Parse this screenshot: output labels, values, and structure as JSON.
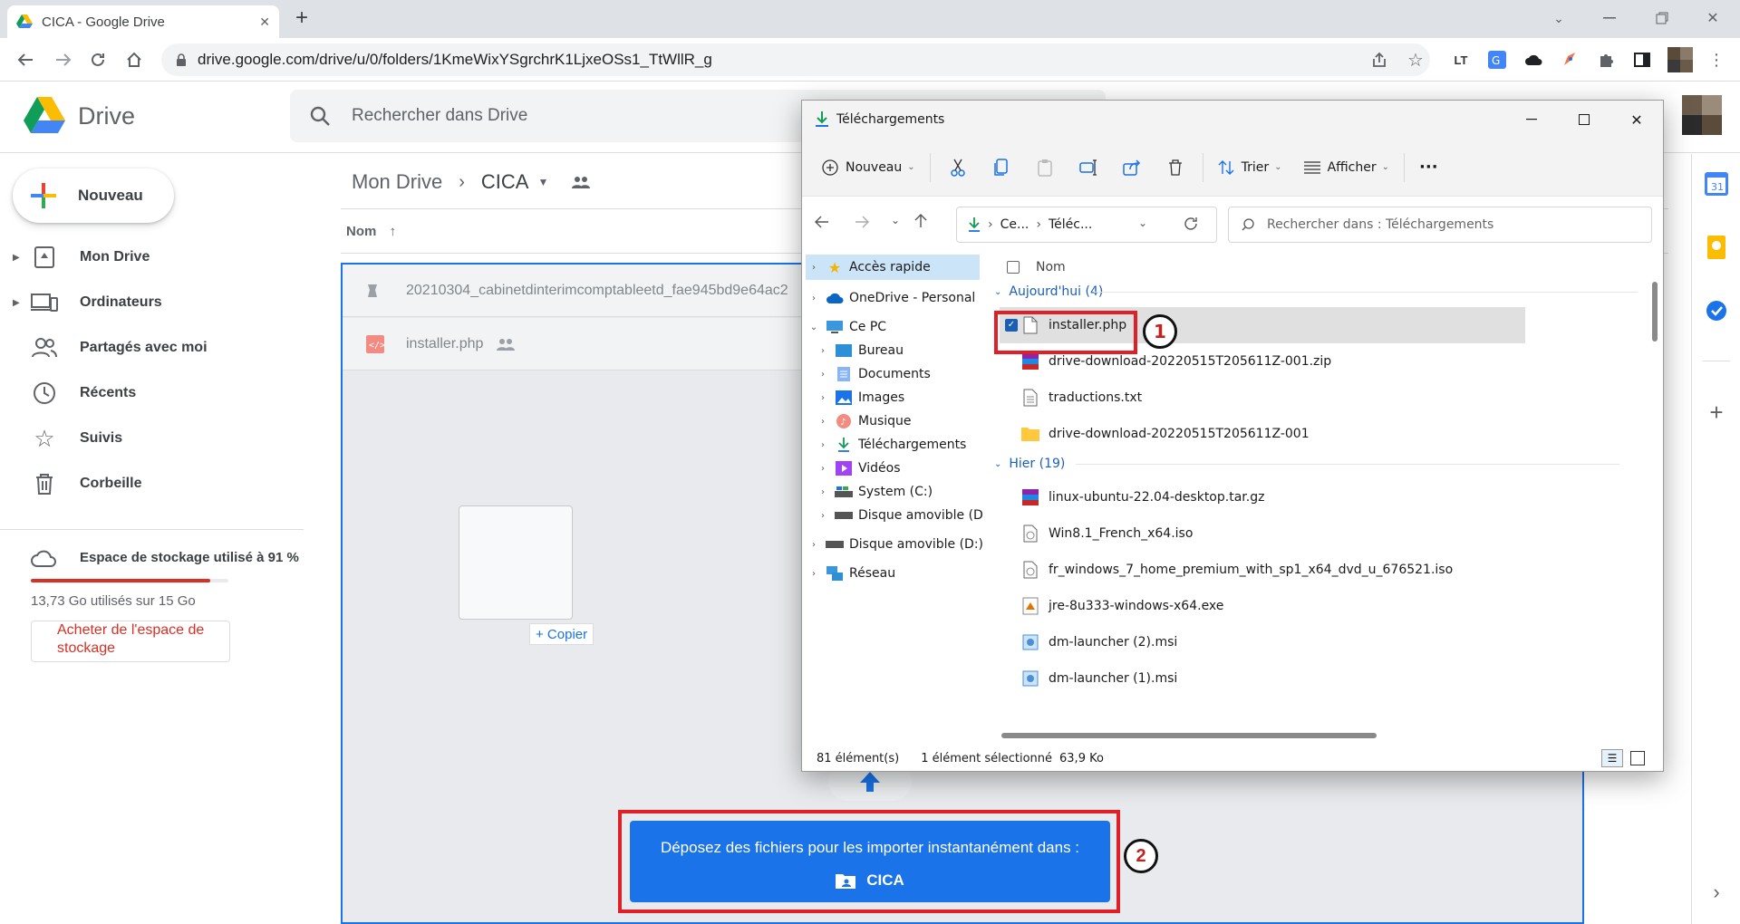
{
  "browser": {
    "tab_title": "CICA - Google Drive",
    "new_tab_label": "+",
    "url": "drive.google.com/drive/u/0/folders/1KmeWixYSgrchrK1LjxeOSs1_TtWllR_g"
  },
  "drive": {
    "app_name": "Drive",
    "search_placeholder": "Rechercher dans Drive",
    "new_label": "Nouveau",
    "nav": [
      {
        "label": "Mon Drive",
        "icon": "my-drive-icon"
      },
      {
        "label": "Ordinateurs",
        "icon": "computers-icon"
      },
      {
        "label": "Partagés avec moi",
        "icon": "shared-icon"
      },
      {
        "label": "Récents",
        "icon": "clock-icon"
      },
      {
        "label": "Suivis",
        "icon": "star-icon"
      },
      {
        "label": "Corbeille",
        "icon": "trash-icon"
      }
    ],
    "storage": {
      "label": "Espace de stockage utilisé à 91 %",
      "used_text": "13,73 Go utilisés sur 15 Go",
      "percent": 91,
      "buy_label": "Acheter de l'espace de stockage"
    },
    "breadcrumb": {
      "root": "Mon Drive",
      "current": "CICA"
    },
    "column_name": "Nom",
    "files": [
      {
        "name": "20210304_cabinetdinterimcomptableetd_fae945bd9e64ac2"
      },
      {
        "name": "installer.php"
      }
    ],
    "copy_label": "+ Copier",
    "drop_banner": {
      "line1": "Déposez des fichiers pour les importer instantanément dans :",
      "folder": "CICA"
    },
    "annotation_1": "1",
    "annotation_2": "2"
  },
  "explorer": {
    "title": "Téléchargements",
    "toolbar": {
      "new_label": "Nouveau",
      "sort_label": "Trier",
      "view_label": "Afficher",
      "more_label": "···"
    },
    "path": {
      "part1": "Ce...",
      "part2": "Téléc..."
    },
    "search_placeholder": "Rechercher dans : Téléchargements",
    "tree": [
      {
        "label": "Accès rapide",
        "indent": 0
      },
      {
        "label": "OneDrive - Personal",
        "indent": 0
      },
      {
        "label": "Ce PC",
        "indent": 0
      },
      {
        "label": "Bureau",
        "indent": 1
      },
      {
        "label": "Documents",
        "indent": 1
      },
      {
        "label": "Images",
        "indent": 1
      },
      {
        "label": "Musique",
        "indent": 1
      },
      {
        "label": "Téléchargements",
        "indent": 1
      },
      {
        "label": "Vidéos",
        "indent": 1
      },
      {
        "label": "System (C:)",
        "indent": 1
      },
      {
        "label": "Disque amovible (D:)",
        "indent": 1
      },
      {
        "label": "Disque amovible (D:)",
        "indent": 0
      },
      {
        "label": "Réseau",
        "indent": 0
      }
    ],
    "column_name": "Nom",
    "groups": [
      {
        "label": "Aujourd'hui (4)"
      },
      {
        "label": "Hier (19)"
      }
    ],
    "files_today": [
      {
        "name": "installer.php",
        "selected": true
      },
      {
        "name": "drive-download-20220515T205611Z-001.zip"
      },
      {
        "name": "traductions.txt"
      },
      {
        "name": "drive-download-20220515T205611Z-001"
      }
    ],
    "files_yesterday": [
      {
        "name": "linux-ubuntu-22.04-desktop.tar.gz"
      },
      {
        "name": "Win8.1_French_x64.iso"
      },
      {
        "name": "fr_windows_7_home_premium_with_sp1_x64_dvd_u_676521.iso"
      },
      {
        "name": "jre-8u333-windows-x64.exe"
      },
      {
        "name": "dm-launcher (2).msi"
      },
      {
        "name": "dm-launcher (1).msi"
      }
    ],
    "status": {
      "count": "81 élément(s)",
      "selection": "1 élément sélectionné",
      "size": "63,9 Ko"
    }
  },
  "colors": {
    "accent": "#1a73e8",
    "annotation": "#e01f26",
    "storage_fill": "#d93025"
  }
}
